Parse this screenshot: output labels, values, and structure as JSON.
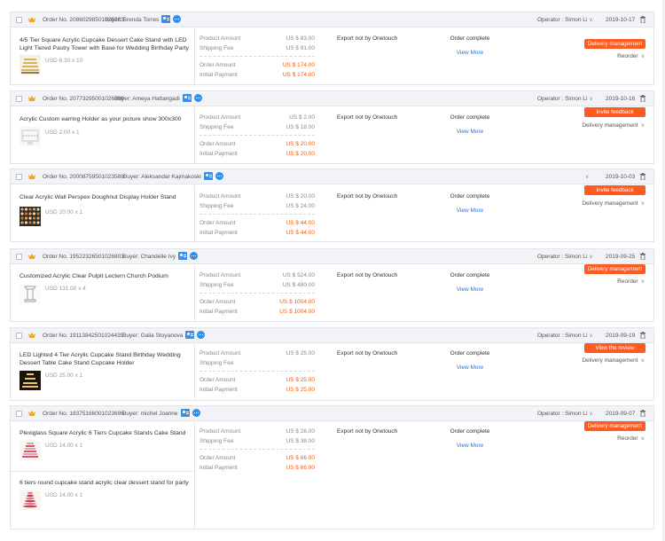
{
  "labels": {
    "order_no_prefix": "Order No.",
    "buyer_prefix": "Buyer:",
    "operator_prefix": "Operator : ",
    "product_amount": "Product Amount",
    "shipping_fee": "Shipping Fee",
    "order_amount": "Order Amount",
    "initial_payment": "Initial Payment",
    "view_more": "View More"
  },
  "colors": {
    "accent": "#ff5a1f",
    "link": "#2f73d9",
    "price_highlight": "#ff5a00",
    "header_bg": "#f1f3f6"
  },
  "orders": [
    {
      "order_no": "20860298501025233",
      "buyer": "Brenda Torres",
      "operator": "Simon Li",
      "date": "2019-10-17",
      "products": [
        {
          "title": "4/5 Tier Square Acrylic Cupcake Dessert Cake Stand with LED Light Tiered Pastry Tower with Base for Wedding Birthday Party",
          "price": "USD 8.30 x 10",
          "thumb": "gold-cake-stand"
        }
      ],
      "product_amount": "US $ 83.00",
      "shipping_fee": "US $ 91.00",
      "order_amount": "US $ 174.00",
      "initial_payment": "US $ 174.00",
      "export": "Export not by Onetouch",
      "status": "Order complete",
      "primary_action": "Delivery management",
      "secondary_action": "Reorder"
    },
    {
      "order_no": "20773295001026899",
      "buyer": "Ameya Hattangadi",
      "operator": "Simon Li",
      "date": "2019-10-16",
      "products": [
        {
          "title": "Acrylic Custom earring Holder as your picture show 300x300",
          "price": "USD 2.00 x 1",
          "thumb": "earring-holder"
        }
      ],
      "product_amount": "US $ 2.00",
      "shipping_fee": "US $ 18.00",
      "order_amount": "US $ 20.00",
      "initial_payment": "US $ 20.00",
      "export": "Export not by Onetouch",
      "status": "Order complete",
      "primary_action": "Invite feedback",
      "secondary_action": "Delivery management"
    },
    {
      "order_no": "20008759501023588",
      "buyer": "Aleksandar Kajmakoski",
      "operator": "",
      "date": "2019-10-03",
      "products": [
        {
          "title": "Clear Acrylic Wall Perspex Doughnut Display Holder Stand",
          "price": "USD 20.00 x 1",
          "thumb": "doughnut-wall"
        }
      ],
      "product_amount": "US $ 20.00",
      "shipping_fee": "US $ 24.00",
      "order_amount": "US $ 44.00",
      "initial_payment": "US $ 44.00",
      "export": "Export not by Onetouch",
      "status": "Order complete",
      "primary_action": "Invite feedback",
      "secondary_action": "Delivery management"
    },
    {
      "order_no": "19522326501026803",
      "buyer": "Chandelle Ivy",
      "operator": "Simon Li",
      "date": "2019-09-25",
      "products": [
        {
          "title": "Customized Acrylic Clear Pulpit Lectern Church Podium",
          "price": "USD 131.00 x 4",
          "thumb": "podium"
        }
      ],
      "product_amount": "US $ 524.00",
      "shipping_fee": "US $ 480.00",
      "order_amount": "US $ 1004.00",
      "initial_payment": "US $ 1004.00",
      "export": "Export not by Onetouch",
      "status": "Order complete",
      "primary_action": "Delivery management",
      "secondary_action": "Reorder"
    },
    {
      "order_no": "19113842501024439",
      "buyer": "Galia Stoyanova",
      "operator": "Simon Li",
      "date": "2019-09-19",
      "products": [
        {
          "title": "LED Lighted 4 Tier Acrylic Cupcake Stand Birthday Wedding Dessert Table Cake Stand Cupcake Holder",
          "price": "USD 25.00 x 1",
          "thumb": "led-cupcake-stand"
        }
      ],
      "product_amount": "US $ 25.00",
      "shipping_fee": "",
      "order_amount": "US $ 25.00",
      "initial_payment": "US $ 25.00",
      "export": "Export not by Onetouch",
      "status": "Order complete",
      "primary_action": "View the review",
      "secondary_action": "Delivery management"
    },
    {
      "order_no": "18375166001023696",
      "buyer": "michel Joanne",
      "operator": "Simon Li",
      "date": "2019-09-07",
      "products": [
        {
          "title": "Plexiglass Square Acrylic 6 Tiers Cupcake Stands Cake Stand",
          "price": "USD 14.00 x 1",
          "thumb": "cupcake-tower"
        },
        {
          "title": "6 tiers round cupcake stand acrylic clear dessert stand for party",
          "price": "USD 14.00 x 1",
          "thumb": "round-cupcake-tower"
        }
      ],
      "product_amount": "US $ 28.00",
      "shipping_fee": "US $ 38.00",
      "order_amount": "US $ 66.00",
      "initial_payment": "US $ 66.00",
      "export": "Export not by Onetouch",
      "status": "Order complete",
      "primary_action": "Delivery management",
      "secondary_action": "Reorder"
    }
  ]
}
